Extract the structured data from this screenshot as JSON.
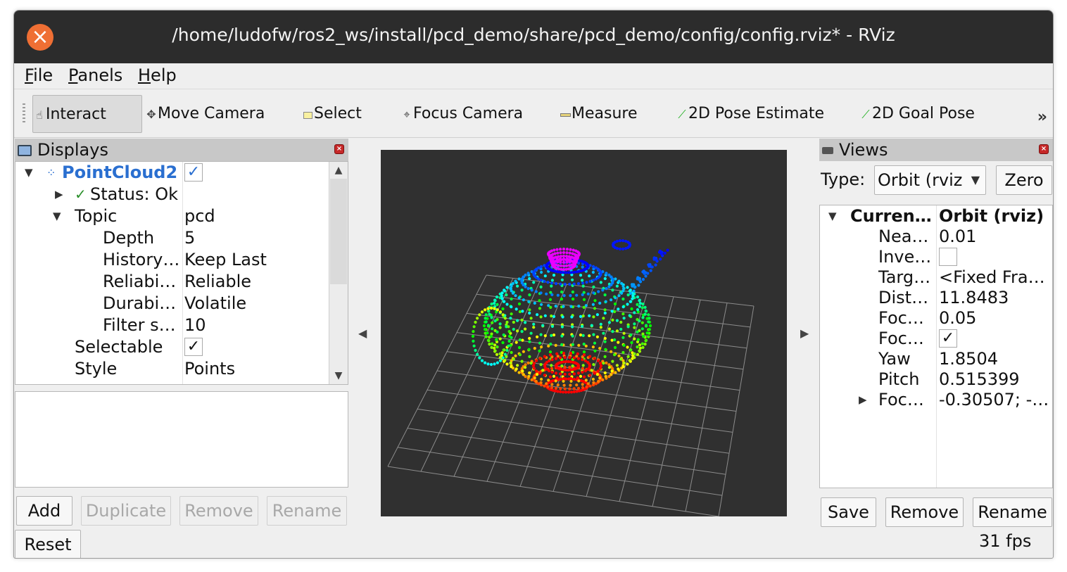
{
  "window": {
    "title": "/home/ludofw/ros2_ws/install/pcd_demo/share/pcd_demo/config/config.rviz* - RViz",
    "close_icon": "close-icon"
  },
  "menu": {
    "file": {
      "accel": "F",
      "rest": "ile"
    },
    "panels": {
      "accel": "P",
      "rest": "anels"
    },
    "help": {
      "accel": "H",
      "rest": "elp"
    }
  },
  "toolbar": {
    "tools": [
      {
        "label": "Interact",
        "icon": "hand-pointer-icon"
      },
      {
        "label": "Move Camera",
        "icon": "move-cross-icon"
      },
      {
        "label": "Select",
        "icon": "select-box-icon"
      },
      {
        "label": "Focus Camera",
        "icon": "focus-target-icon"
      },
      {
        "label": "Measure",
        "icon": "ruler-icon"
      },
      {
        "label": "2D Pose Estimate",
        "icon": "green-arrow-icon"
      },
      {
        "label": "2D Goal Pose",
        "icon": "green-arrow-icon"
      }
    ],
    "overflow": "»"
  },
  "displays": {
    "header": "Displays",
    "rows": [
      {
        "name": "PointCloud2",
        "value": "✓"
      },
      {
        "name": "Status: Ok",
        "value": ""
      },
      {
        "name": "Topic",
        "value": "pcd"
      },
      {
        "name": "Depth",
        "value": "5"
      },
      {
        "name": "History…",
        "value": "Keep Last"
      },
      {
        "name": "Reliabi…",
        "value": "Reliable"
      },
      {
        "name": "Durabi…",
        "value": "Volatile"
      },
      {
        "name": "Filter s…",
        "value": "10"
      },
      {
        "name": "Selectable",
        "value": "✓"
      },
      {
        "name": "Style",
        "value": "Points"
      }
    ],
    "status_check": "✓",
    "buttons": {
      "add": "Add",
      "duplicate": "Duplicate",
      "remove": "Remove",
      "rename": "Rename",
      "reset": "Reset"
    }
  },
  "views": {
    "header": "Views",
    "type_label": "Type:",
    "type_value": "Orbit (rviz",
    "zero": "Zero",
    "rows": [
      {
        "name": "Curren…",
        "value": "Orbit (rviz)"
      },
      {
        "name": "Nea…",
        "value": "0.01"
      },
      {
        "name": "Inve…",
        "value": ""
      },
      {
        "name": "Targ…",
        "value": "<Fixed Fra…"
      },
      {
        "name": "Dist…",
        "value": "11.8483"
      },
      {
        "name": "Foc…",
        "value": "0.05"
      },
      {
        "name": "Foc…",
        "value": "✓"
      },
      {
        "name": "Yaw",
        "value": "1.8504"
      },
      {
        "name": "Pitch",
        "value": "0.515399"
      },
      {
        "name": "Foc…",
        "value": "-0.30507; -…"
      }
    ],
    "buttons": {
      "save": "Save",
      "remove": "Remove",
      "rename": "Rename"
    },
    "fps": "31 fps"
  },
  "colors": {
    "accent_blue": "#2a6fd0",
    "close_orange": "#ef6f34",
    "viewport_bg": "#303030",
    "grid": "#8c8c8c"
  }
}
